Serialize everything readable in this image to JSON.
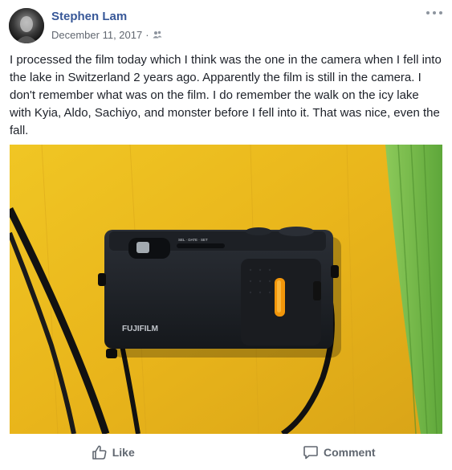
{
  "post": {
    "author": "Stephen Lam",
    "date": "December 11, 2017",
    "separator": "·",
    "privacy_icon": "friends-icon",
    "text": "I processed the film today which I think was the one in the camera when I fell into the lake in Switzerland 2 years ago. Apparently the film is still in the camera. I don't remember what was on the film. I do remember the walk on the icy lake with Kyia, Aldo, Sachiyo, and monster before I fell into it. That was nice, even the fall.",
    "photo": {
      "camera_brand": "FUJIFILM",
      "camera_dial_text": "SEL · DATE · SET"
    }
  },
  "actions": {
    "like_label": "Like",
    "comment_label": "Comment"
  },
  "colors": {
    "author_link": "#385898",
    "meta_text": "#616770",
    "background_table": "#e8b91a"
  }
}
